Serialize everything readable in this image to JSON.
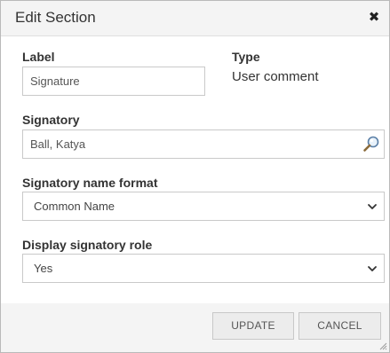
{
  "dialog": {
    "title": "Edit Section",
    "close_icon": "close-icon",
    "close_glyph": "✖"
  },
  "form": {
    "label": {
      "label": "Label",
      "value": "Signature"
    },
    "type": {
      "label": "Type",
      "value": "User comment"
    },
    "signatory": {
      "label": "Signatory",
      "value": "Ball, Katya",
      "icon": "search-icon"
    },
    "name_format": {
      "label": "Signatory name format",
      "selected": "Common Name"
    },
    "display_role": {
      "label": "Display signatory role",
      "selected": "Yes"
    }
  },
  "footer": {
    "update_label": "UPDATE",
    "cancel_label": "CANCEL"
  }
}
